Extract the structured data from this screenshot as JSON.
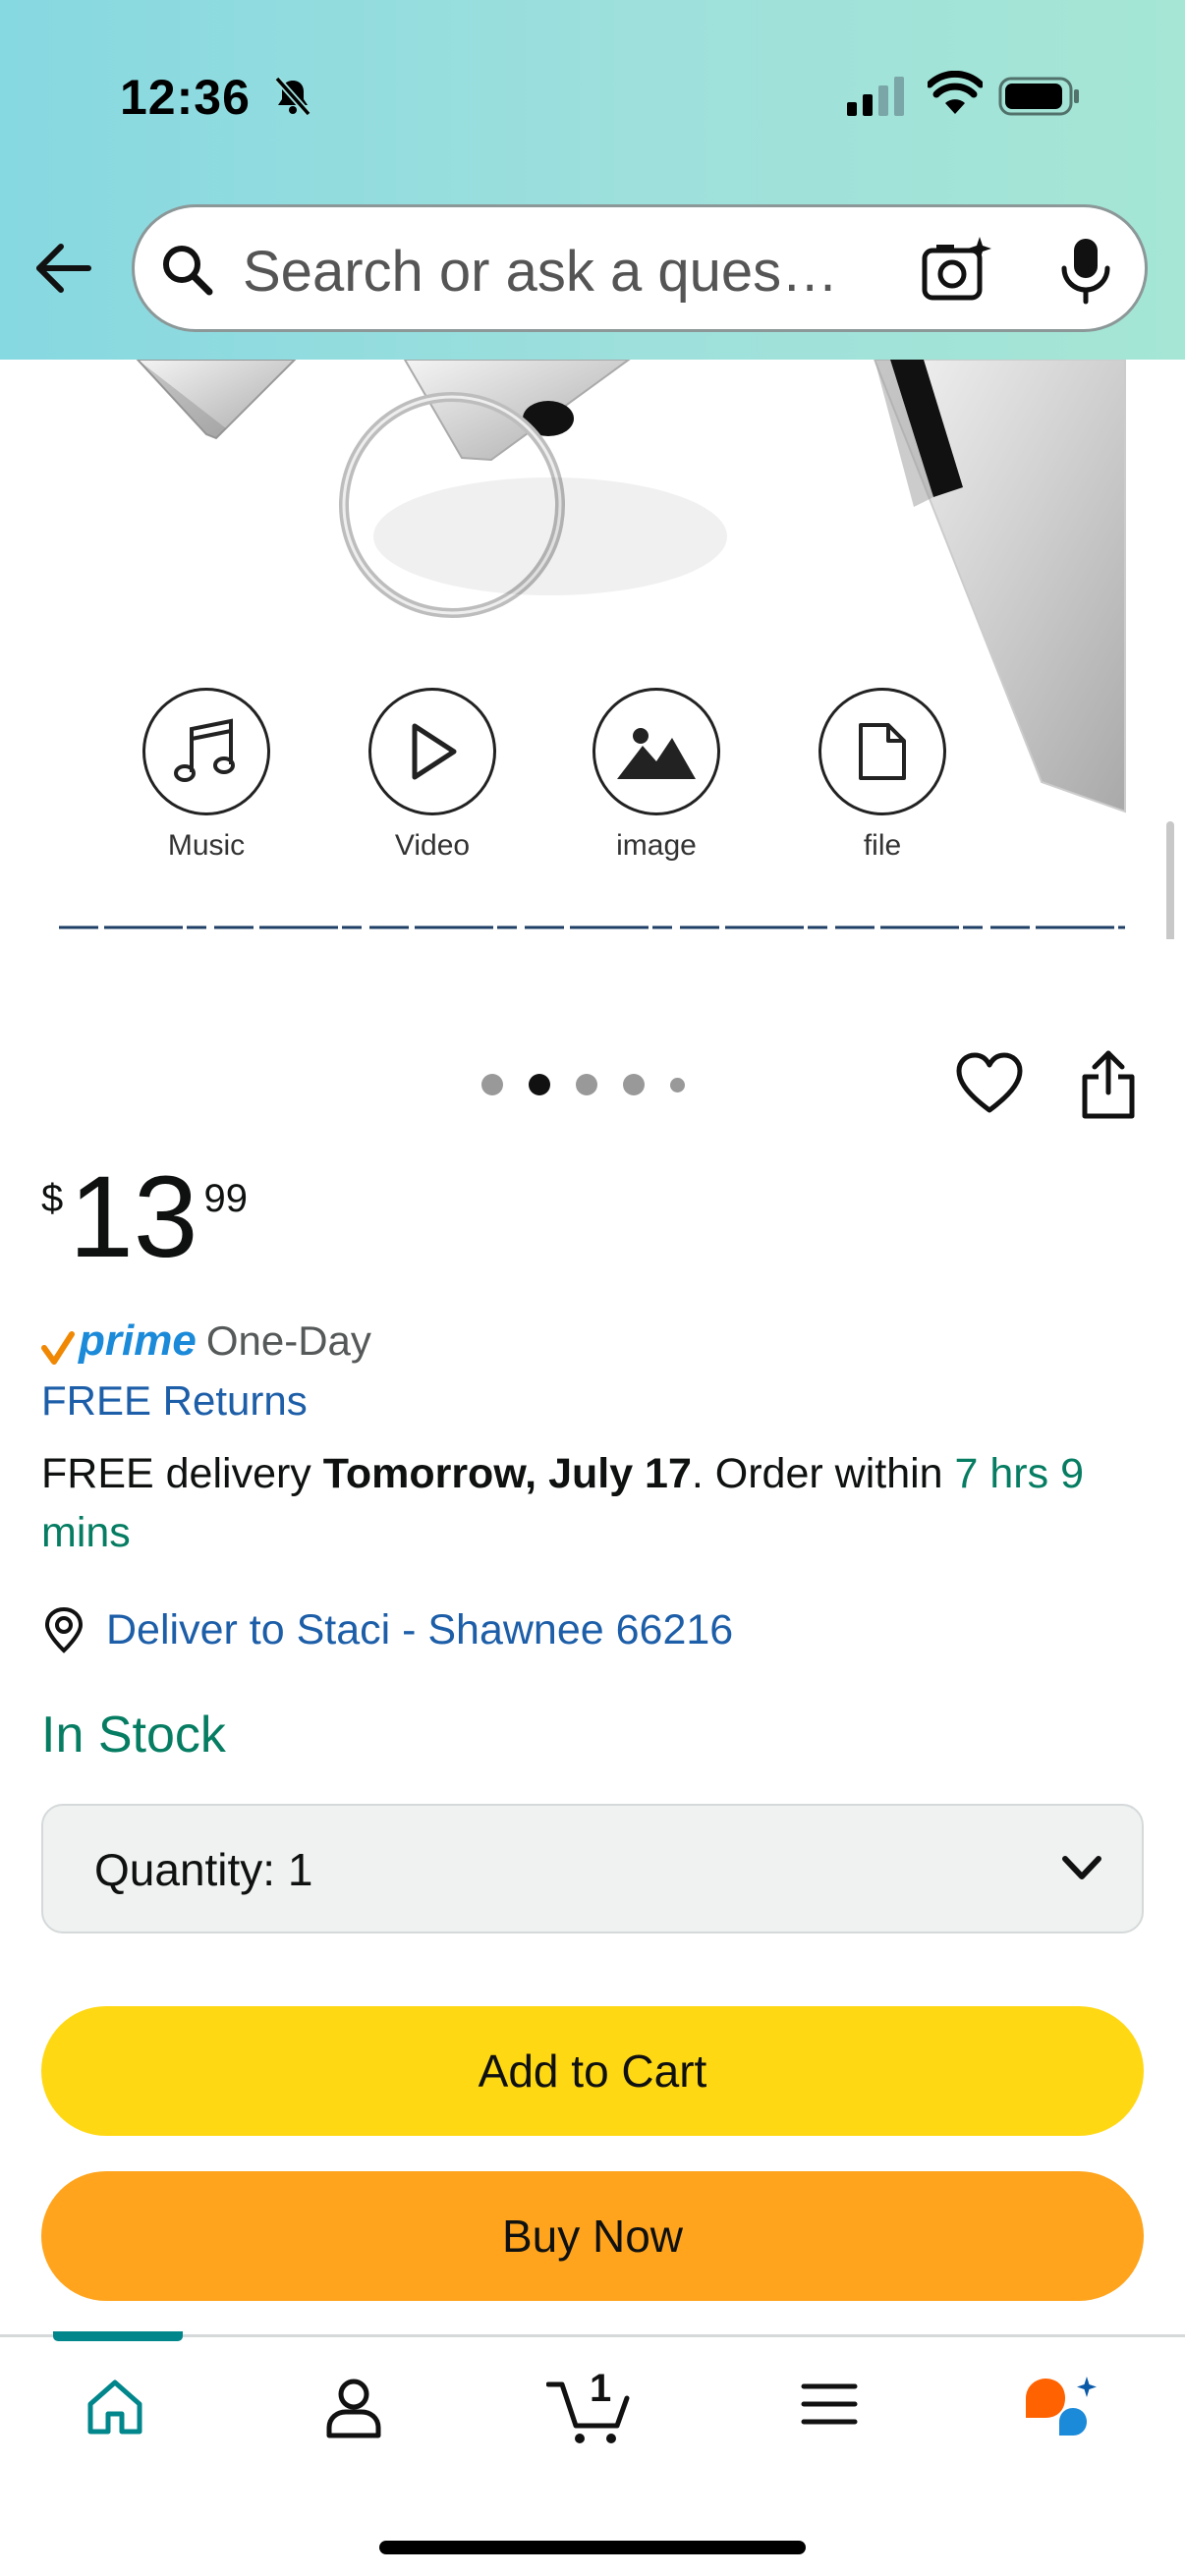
{
  "status_bar": {
    "time": "12:36"
  },
  "search": {
    "placeholder": "Search or ask a ques…"
  },
  "product_image": {
    "features": [
      {
        "label": "Music",
        "icon": "music-note-icon"
      },
      {
        "label": "Video",
        "icon": "play-icon"
      },
      {
        "label": "image",
        "icon": "image-icon"
      },
      {
        "label": "file",
        "icon": "file-icon"
      }
    ]
  },
  "carousel": {
    "total_dots": 5,
    "active_index": 1
  },
  "price": {
    "symbol": "$",
    "whole": "13",
    "fraction": "99"
  },
  "prime": {
    "badge": "prime",
    "speed": "One-Day",
    "returns": "FREE Returns"
  },
  "delivery": {
    "prefix": "FREE delivery ",
    "date": "Tomorrow, July 17",
    "middle": ". Order within ",
    "countdown": "7 hrs 9 mins"
  },
  "deliver_to": {
    "text": "Deliver to Staci - Shawnee 66216"
  },
  "stock": {
    "status": "In Stock"
  },
  "quantity": {
    "label": "Quantity:",
    "value": "1"
  },
  "buttons": {
    "add_to_cart": "Add to Cart",
    "buy_now": "Buy Now"
  },
  "bottom_nav": {
    "items": [
      "home-icon",
      "account-icon",
      "cart-icon",
      "menu-icon",
      "ai-assistant-icon"
    ],
    "cart_count": "1",
    "active": "home-icon"
  },
  "colors": {
    "header_gradient_start": "#86d8e1",
    "header_gradient_end": "#a5e6d5",
    "link_blue": "#1d5ea8",
    "prime_blue": "#1a8ad9",
    "stock_green": "#067d62",
    "add_to_cart_yellow": "#ffd814",
    "buy_now_orange": "#ffa41c",
    "nav_active_teal": "#00868b"
  }
}
